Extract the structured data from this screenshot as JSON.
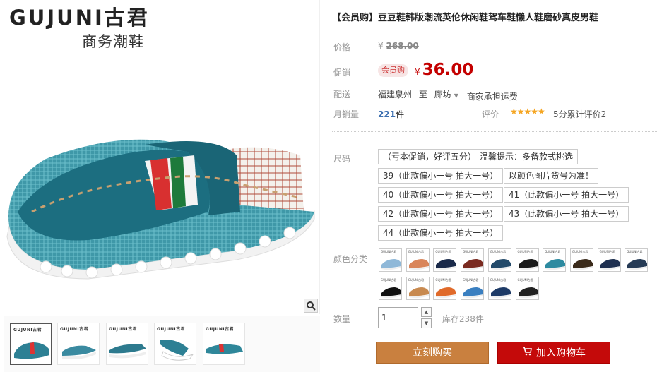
{
  "brand": {
    "en": "GUJUNI古君",
    "cn": "商务潮鞋"
  },
  "thumbs": {
    "label": "GUJUNI古君"
  },
  "product": {
    "title": "【会员购】豆豆鞋韩版潮流英伦休闲鞋驾车鞋懒人鞋磨砂真皮男鞋",
    "labels": {
      "price": "价格",
      "promo": "促销",
      "shipping": "配送",
      "monthly_sales": "月销量",
      "rating": "评价",
      "size": "尺码",
      "color": "颜色分类",
      "quantity": "数量"
    },
    "original_price": {
      "currency": "¥",
      "value": "268.00"
    },
    "promo_tag": "会员购",
    "promo_price": {
      "currency": "¥",
      "value": "36.00"
    },
    "shipping": {
      "from": "福建泉州",
      "to_word": "至",
      "to": "廊坊",
      "note": "商家承担运费"
    },
    "sales": {
      "count": "221",
      "unit": "件"
    },
    "rating": {
      "stars": "★★★★★",
      "text": "5分累计评价2"
    },
    "sizes": [
      "（亏本促销，好评五分）",
      "温馨提示：多备款式挑选",
      "39（此款偏小一号 拍大一号）",
      "以颜色图片货号为准！",
      "40（此款偏小一号 拍大一号）",
      "41（此款偏小一号 拍大一号）",
      "42（此款偏小一号 拍大一号）",
      "43（此款偏小一号 拍大一号）",
      "44（此款偏小一号 拍大一号）"
    ],
    "swatch_label": "GUJUNI古君",
    "quantity": {
      "value": "1",
      "up": "▲",
      "down": "▼"
    },
    "stock": "库存238件",
    "buy_button": "立刻购买",
    "cart_button": "加入购物车"
  }
}
